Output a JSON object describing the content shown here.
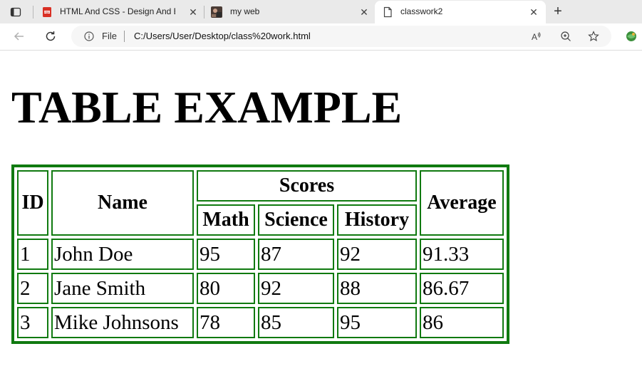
{
  "browser": {
    "tabs": [
      {
        "title": "HTML And CSS - Design And Buil",
        "favicon": "pdf-icon"
      },
      {
        "title": "my web",
        "favicon": "photo-thumbnail-icon"
      },
      {
        "title": "classwork2",
        "favicon": "page-icon",
        "active": true
      }
    ],
    "address": {
      "scheme_label": "File",
      "url": "C:/Users/User/Desktop/class%20work.html"
    },
    "colors": {
      "tabbar_bg": "#eaeaea",
      "toolbar_bg": "#ffffff",
      "addressbar_bg": "#f6f6f6"
    }
  },
  "page": {
    "heading": "TABLE EXAMPLE",
    "table": {
      "border_color": "#107a10",
      "headers": {
        "id": "ID",
        "name": "Name",
        "scores_group": "Scores",
        "math": "Math",
        "science": "Science",
        "history": "History",
        "average": "Average"
      },
      "rows": [
        {
          "id": "1",
          "name": "John Doe",
          "math": "95",
          "science": "87",
          "history": "92",
          "average": "91.33"
        },
        {
          "id": "2",
          "name": "Jane Smith",
          "math": "80",
          "science": "92",
          "history": "88",
          "average": "86.67"
        },
        {
          "id": "3",
          "name": "Mike Johnsons",
          "math": "78",
          "science": "85",
          "history": "95",
          "average": "86"
        }
      ]
    }
  }
}
